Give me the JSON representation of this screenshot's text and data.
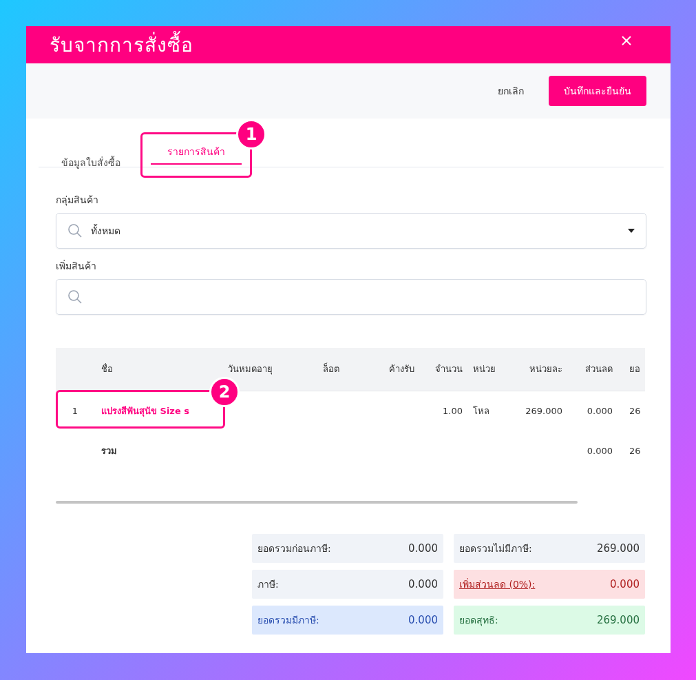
{
  "window": {
    "title": "รับจากการสั่งซื้อ"
  },
  "toolbar": {
    "buttons": [
      {
        "label": "ยกเลิก",
        "kind": "plain"
      },
      {
        "label": "บันทึกและยืนยัน",
        "kind": "primary"
      }
    ]
  },
  "tabs": [
    {
      "label": "ข้อมูลใบสั่งซื้อ",
      "selected": false
    },
    {
      "label": "รายการสินค้า",
      "selected": true,
      "callout": "1"
    }
  ],
  "fields": [
    {
      "label": "กลุ่มสินค้า",
      "value": "ทั้งหมด",
      "kind": "dropdown"
    },
    {
      "label": "เพิ่มสินค้า",
      "kind": "search"
    }
  ],
  "table": {
    "columns": [
      "",
      "ชื่อ",
      "วันหมดอายุ",
      "ล็อต",
      "ค้างรับ",
      "จำนวน",
      "หน่วย",
      "หน่วยละ",
      "ส่วนลด",
      "ยอ"
    ],
    "rows": [
      {
        "cells": [
          "1",
          "แปรงสีฟันสุนัข Size s",
          "",
          "",
          "",
          "1.00",
          "โหล",
          "269.000",
          "0.000",
          "26"
        ],
        "kind": "item",
        "callout": "2"
      },
      {
        "cells": [
          "",
          "รวม",
          "",
          "",
          "",
          "",
          "",
          "",
          "0.000",
          "26"
        ],
        "kind": "total"
      }
    ]
  },
  "summary": [
    {
      "label": "ยอดรวมก่อนภาษี:",
      "value": "0.000",
      "kind": "neutral"
    },
    {
      "label": "ยอดรวมไม่มีภาษี:",
      "value": "269.000",
      "kind": "neutral"
    },
    {
      "label": "ภาษี:",
      "value": "0.000",
      "kind": "neutral"
    },
    {
      "label": "เพิ่มส่วนลด (0%):",
      "value": "0.000",
      "kind": "danger"
    },
    {
      "label": "ยอดรวมมีภาษี:",
      "value": "0.000",
      "kind": "info"
    },
    {
      "label": "ยอดสุทธิ:",
      "value": "269.000",
      "kind": "success"
    }
  ]
}
